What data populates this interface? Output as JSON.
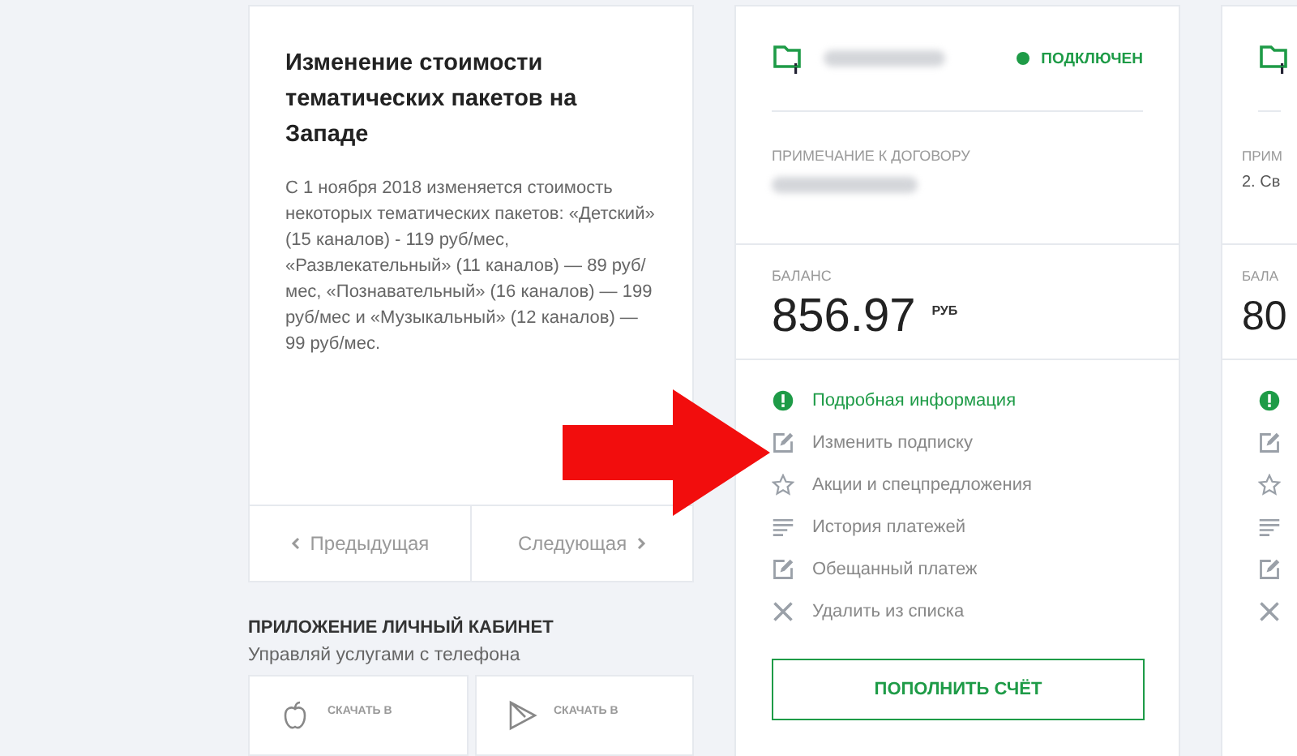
{
  "news": {
    "title": "Изменение стоимости тематических пакетов на Западе",
    "body": "С 1 ноября 2018 изменяется стоимость некоторых тематических пакетов: «Детский» (15 каналов) - 119 руб/мес, «Развлекательный» (11 каналов) — 89 руб/мес, «Познавательный» (16 каналов) — 199 руб/мес и «Музыкальный» (12 каналов) — 99 руб/мес.",
    "prev": "Предыдущая",
    "next": "Следующая"
  },
  "app_promo": {
    "title": "ПРИЛОЖЕНИЕ ЛИЧНЫЙ КАБИНЕТ",
    "subtitle": "Управляй услугами с телефона",
    "stores": [
      {
        "kind": "apple",
        "caption": "СКАЧАТЬ В"
      },
      {
        "kind": "play",
        "caption": "СКАЧАТЬ В"
      }
    ]
  },
  "accounts": [
    {
      "status": "ПОДКЛЮЧЕН",
      "note_label": "ПРИМЕЧАНИЕ К ДОГОВОРУ",
      "balance_label": "БАЛАНС",
      "balance": "856.97",
      "currency": "РУБ",
      "menu": [
        {
          "kind": "info",
          "label": "Подробная информация",
          "active": true
        },
        {
          "kind": "edit",
          "label": "Изменить подписку",
          "active": false
        },
        {
          "kind": "star",
          "label": "Акции и спецпредложения",
          "active": false
        },
        {
          "kind": "list",
          "label": "История платежей",
          "active": false
        },
        {
          "kind": "edit",
          "label": "Обещанный платеж",
          "active": false
        },
        {
          "kind": "close",
          "label": "Удалить из списка",
          "active": false
        }
      ],
      "button": "ПОПОЛНИТЬ СЧЁТ"
    },
    {
      "note_label": "ПРИМ",
      "note": "2. Св",
      "balance_label": "БАЛА",
      "balance": "80",
      "menu": [
        {
          "kind": "info",
          "active": true
        },
        {
          "kind": "edit",
          "active": false
        },
        {
          "kind": "star",
          "active": false
        },
        {
          "kind": "list",
          "active": false
        },
        {
          "kind": "edit",
          "active": false
        },
        {
          "kind": "close",
          "active": false
        }
      ]
    }
  ]
}
